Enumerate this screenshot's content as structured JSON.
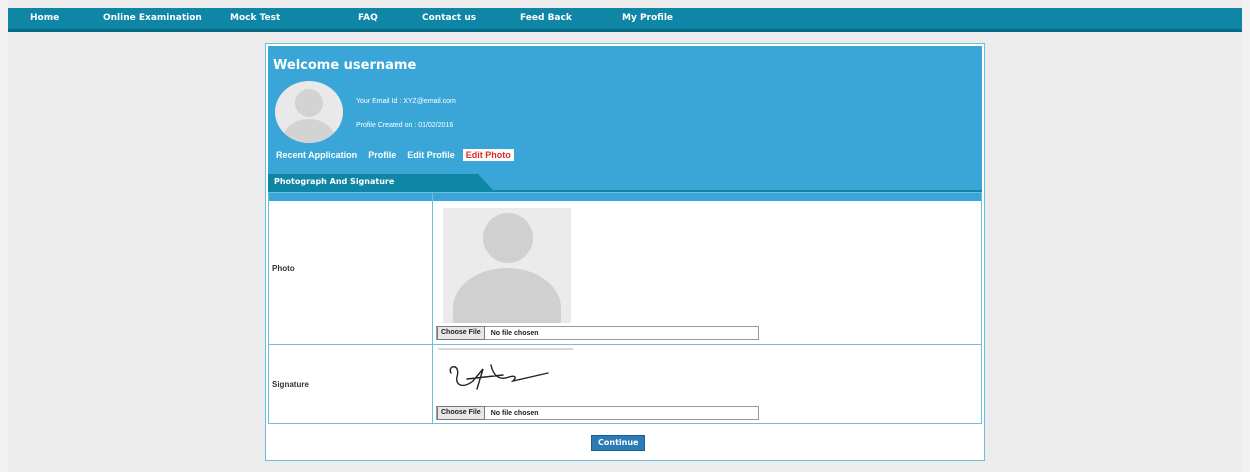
{
  "nav": {
    "items": [
      "Home",
      "Online Examination",
      "Mock Test",
      "FAQ",
      "Contact us",
      "Feed Back",
      "My Profile"
    ]
  },
  "profile": {
    "welcome": "Welcome username",
    "email_line": "Your Email Id : XYZ@email.com",
    "created_line": "Profile Created on : 01/02/2016"
  },
  "tabs": [
    "Recent Application",
    "Profile",
    "Edit Profile",
    "Edit Photo"
  ],
  "active_tab": "Edit Photo",
  "section": {
    "title": "Photograph And Signature"
  },
  "form": {
    "photo_label": "Photo",
    "signature_label": "Signature",
    "choose_file_label": "Choose File",
    "no_file_text": "No file chosen",
    "continue_label": "Continue"
  },
  "colors": {
    "nav_bg": "#0f86a6",
    "header_bg": "#3aa6d8",
    "active_tab_text": "#e02a2a",
    "button_bg": "#2c7bb6"
  }
}
